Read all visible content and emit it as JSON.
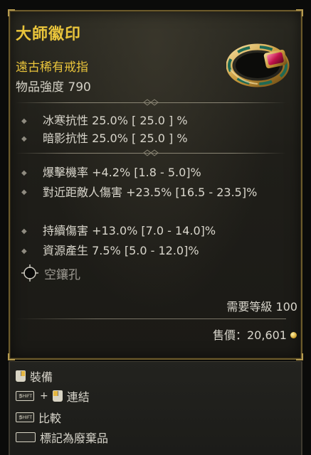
{
  "item": {
    "name": "大師徽印",
    "type": "遠古稀有戒指",
    "power": "物品強度 790"
  },
  "resists": [
    {
      "text": "冰寒抗性 25.0%  [ 25.0 ] %"
    },
    {
      "text": "暗影抗性 25.0%  [ 25.0 ] %"
    }
  ],
  "affixes": [
    {
      "text": "爆擊機率 +4.2% [1.8 - 5.0]%"
    },
    {
      "text": "對近距敵人傷害 +23.5% [16.5 - 23.5]%"
    },
    {
      "text": "持續傷害 +13.0% [7.0 - 14.0]%"
    },
    {
      "text": "資源產生 7.5% [5.0 - 12.0]%"
    }
  ],
  "socket": {
    "label": "空鑲孔",
    "icon": "empty-socket-icon"
  },
  "requirement": "需要等級 100",
  "price": "售價：20,601",
  "controls": {
    "equip": "裝備",
    "link": "連結",
    "compare": "比較",
    "junk": "標記為廢棄品",
    "shift_key": "SHIFT",
    "plus": "+"
  },
  "colors": {
    "name": "#e9c43b",
    "text": "#d9d6cc",
    "border": "#6b5a2b"
  }
}
